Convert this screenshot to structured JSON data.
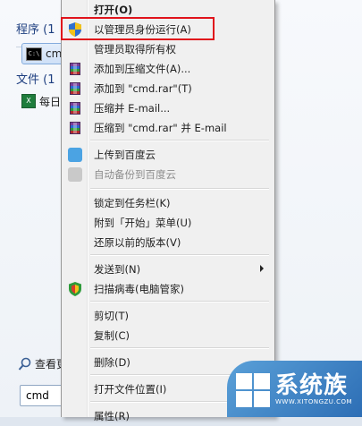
{
  "start_menu": {
    "programs_heading": "程序 (1",
    "program_item": "cm",
    "files_heading": "文件 (1",
    "file_item": "每日",
    "see_more": "查看更",
    "search_value": "cmd"
  },
  "context_menu": {
    "items": [
      {
        "label": "打开(O)",
        "bold": true,
        "icon": "none"
      },
      {
        "label": "以管理员身份运行(A)",
        "icon": "uac-shield-icon"
      },
      {
        "label": "管理员取得所有权",
        "icon": "none"
      },
      {
        "label": "添加到压缩文件(A)...",
        "icon": "winrar-icon"
      },
      {
        "label": "添加到 \"cmd.rar\"(T)",
        "icon": "winrar-icon"
      },
      {
        "label": "压缩并 E-mail...",
        "icon": "winrar-icon"
      },
      {
        "label": "压缩到 \"cmd.rar\" 并 E-mail",
        "icon": "winrar-icon"
      },
      {
        "label": "上传到百度云",
        "icon": "baidu-cloud-icon"
      },
      {
        "label": "自动备份到百度云",
        "icon": "baidu-cloud-icon",
        "disabled": true
      },
      {
        "label": "锁定到任务栏(K)",
        "icon": "none"
      },
      {
        "label": "附到「开始」菜单(U)",
        "icon": "none"
      },
      {
        "label": "还原以前的版本(V)",
        "icon": "none"
      },
      {
        "label": "发送到(N)",
        "icon": "none",
        "submenu": true
      },
      {
        "label": "扫描病毒(电脑管家)",
        "icon": "guard-shield-icon"
      },
      {
        "label": "剪切(T)",
        "icon": "none"
      },
      {
        "label": "复制(C)",
        "icon": "none"
      },
      {
        "label": "删除(D)",
        "icon": "none"
      },
      {
        "label": "打开文件位置(I)",
        "icon": "none"
      },
      {
        "label": "属性(R)",
        "icon": "none"
      }
    ]
  },
  "logo": {
    "main": "系统族",
    "sub": "WWW.XITONGZU.COM"
  },
  "colors": {
    "highlight_border": "#e0141b",
    "menu_bg": "#f0f0f0",
    "logo_blue": "#2d6eb5"
  }
}
